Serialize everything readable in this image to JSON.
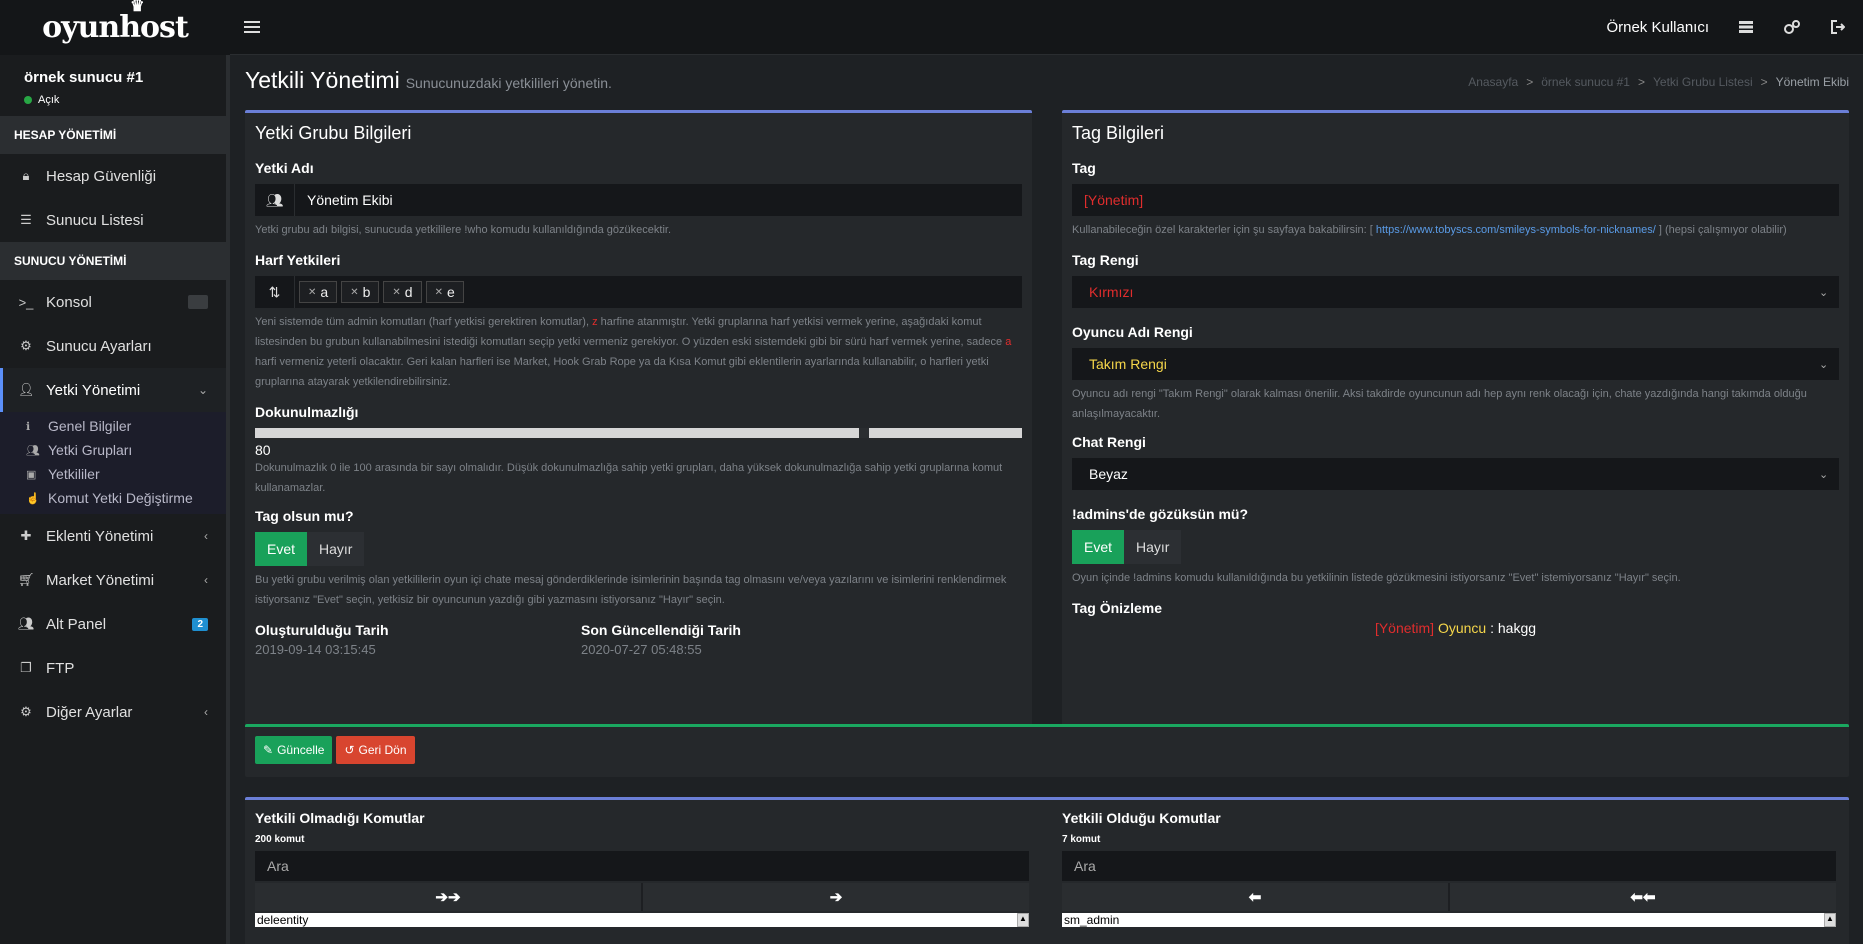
{
  "brand": {
    "logo_text": "oyunhost",
    "crown": "♛"
  },
  "topbar": {
    "user": "Örnek Kullanıcı"
  },
  "sidebar": {
    "server_name": "örnek sunucu #1",
    "server_status": "Açık",
    "section1": "HESAP YÖNETİMİ",
    "account_security": "Hesap Güvenliği",
    "server_list": "Sunucu Listesi",
    "section2": "SUNUCU YÖNETİMİ",
    "console": "Konsol",
    "server_settings": "Sunucu Ayarları",
    "admin_mgmt": "Yetki Yönetimi",
    "sub": {
      "general": "Genel Bilgiler",
      "groups": "Yetki Grupları",
      "admins": "Yetkililer",
      "cmd_change": "Komut Yetki Değiştirme"
    },
    "plugins": "Eklenti Yönetimi",
    "market": "Market Yönetimi",
    "subpanel": "Alt Panel",
    "subpanel_badge": "2",
    "ftp": "FTP",
    "other": "Diğer Ayarlar"
  },
  "page": {
    "title": "Yetkili Yönetimi",
    "subtitle": "Sunucunuzdaki yetkilileri yönetin.",
    "breadcrumb": [
      "Anasayfa",
      "örnek sunucu #1",
      "Yetki Grubu Listesi",
      "Yönetim Ekibi"
    ]
  },
  "group_box": {
    "title": "Yetki Grubu Bilgileri",
    "name_label": "Yetki Adı",
    "name_value": "Yönetim Ekibi",
    "name_help": "Yetki grubu adı bilgisi, sunucuda yetkililere !who komudu kullanıldığında gözükecektir.",
    "flags_label": "Harf Yetkileri",
    "flags": [
      "a",
      "b",
      "d",
      "e"
    ],
    "flags_help_1": "Yeni sistemde tüm admin komutları (harf yetkisi gerektiren komutlar), ",
    "flags_help_z": "z",
    "flags_help_2": " harfine atanmıştır. Yetki gruplarına harf yetkisi vermek yerine, aşağıdaki komut listesinden bu grubun kullanabilmesini istediği komutları seçip yetki vermeniz gerekiyor. O yüzden eski sistemdeki gibi bir sürü harf vermek yerine, sadece ",
    "flags_help_a": "a",
    "flags_help_3": " harfi vermeniz yeterli olacaktır. Geri kalan harfleri ise Market, Hook Grab Rope ya da Kısa Komut gibi eklentilerin ayarlarında kullanabilir, o harfleri yetki gruplarına atayarak yetkilendirebilirsiniz.",
    "immunity_label": "Dokunulmazlığı",
    "immunity_value": "80",
    "immunity_fraction": 0.8,
    "immunity_help": "Dokunulmazlık 0 ile 100 arasında bir sayı olmalıdır. Düşük dokunulmazlığa sahip yetki grupları, daha yüksek dokunulmazlığa sahip yetki gruplarına komut kullanamazlar.",
    "tag_q": "Tag olsun mu?",
    "yes": "Evet",
    "no": "Hayır",
    "tag_help": "Bu yetki grubu verilmiş olan yetkililerin oyun içi chate mesaj gönderdiklerinde isimlerinin başında tag olmasını ve/veya yazılarını ve isimlerini renklendirmek istiyorsanız \"Evet\" seçin, yetkisiz bir oyuncunun yazdığı gibi yazmasını istiyorsanız \"Hayır\" seçin.",
    "created_label": "Oluşturulduğu Tarih",
    "created_value": "2019-09-14 03:15:45",
    "updated_label": "Son Güncellendiği Tarih",
    "updated_value": "2020-07-27 05:48:55"
  },
  "tag_box": {
    "title": "Tag Bilgileri",
    "tag_label": "Tag",
    "tag_value": "[Yönetim]",
    "tag_help_1": "Kullanabileceğin özel karakterler için şu sayfaya bakabilirsin: [ ",
    "tag_help_link": "https://www.tobyscs.com/smileys-symbols-for-nicknames/",
    "tag_help_2": " ] (hepsi çalışmıyor olabilir)",
    "tag_color_label": "Tag Rengi",
    "tag_color_value": "Kırmızı",
    "name_color_label": "Oyuncu Adı Rengi",
    "name_color_value": "Takım Rengi",
    "name_color_help": "Oyuncu adı rengi \"Takım Rengi\" olarak kalması önerilir. Aksi takdirde oyuncunun adı hep aynı renk olacağı için, chate yazdığında hangi takımda olduğu anlaşılmayacaktır.",
    "chat_color_label": "Chat Rengi",
    "chat_color_value": "Beyaz",
    "admins_q": "!admins'de gözüksün mü?",
    "yes": "Evet",
    "no": "Hayır",
    "admins_help": "Oyun içinde !admins komudu kullanıldığında bu yetkilinin listede gözükmesini istiyorsanız \"Evet\" istemiyorsanız \"Hayır\" seçin.",
    "preview_label": "Tag Önizleme",
    "preview_tag": "[Yönetim]",
    "preview_name": "Oyuncu",
    "preview_sep": " : ",
    "preview_msg": "hakgg"
  },
  "actions": {
    "update": "Güncelle",
    "revert": "Geri Dön"
  },
  "commands": {
    "left_title": "Yetkili Olmadığı Komutlar",
    "left_count": "200 komut",
    "left_first": "deleentity",
    "right_title": "Yetkili Olduğu Komutlar",
    "right_count": "7 komut",
    "right_first": "sm_admin",
    "search_placeholder": "Ara"
  },
  "colors": {
    "accent": "#6b7fd7",
    "green": "#19a15a",
    "red": "#d8452f",
    "tag_red": "#e02d2d",
    "team_yellow": "#f5d64a"
  }
}
